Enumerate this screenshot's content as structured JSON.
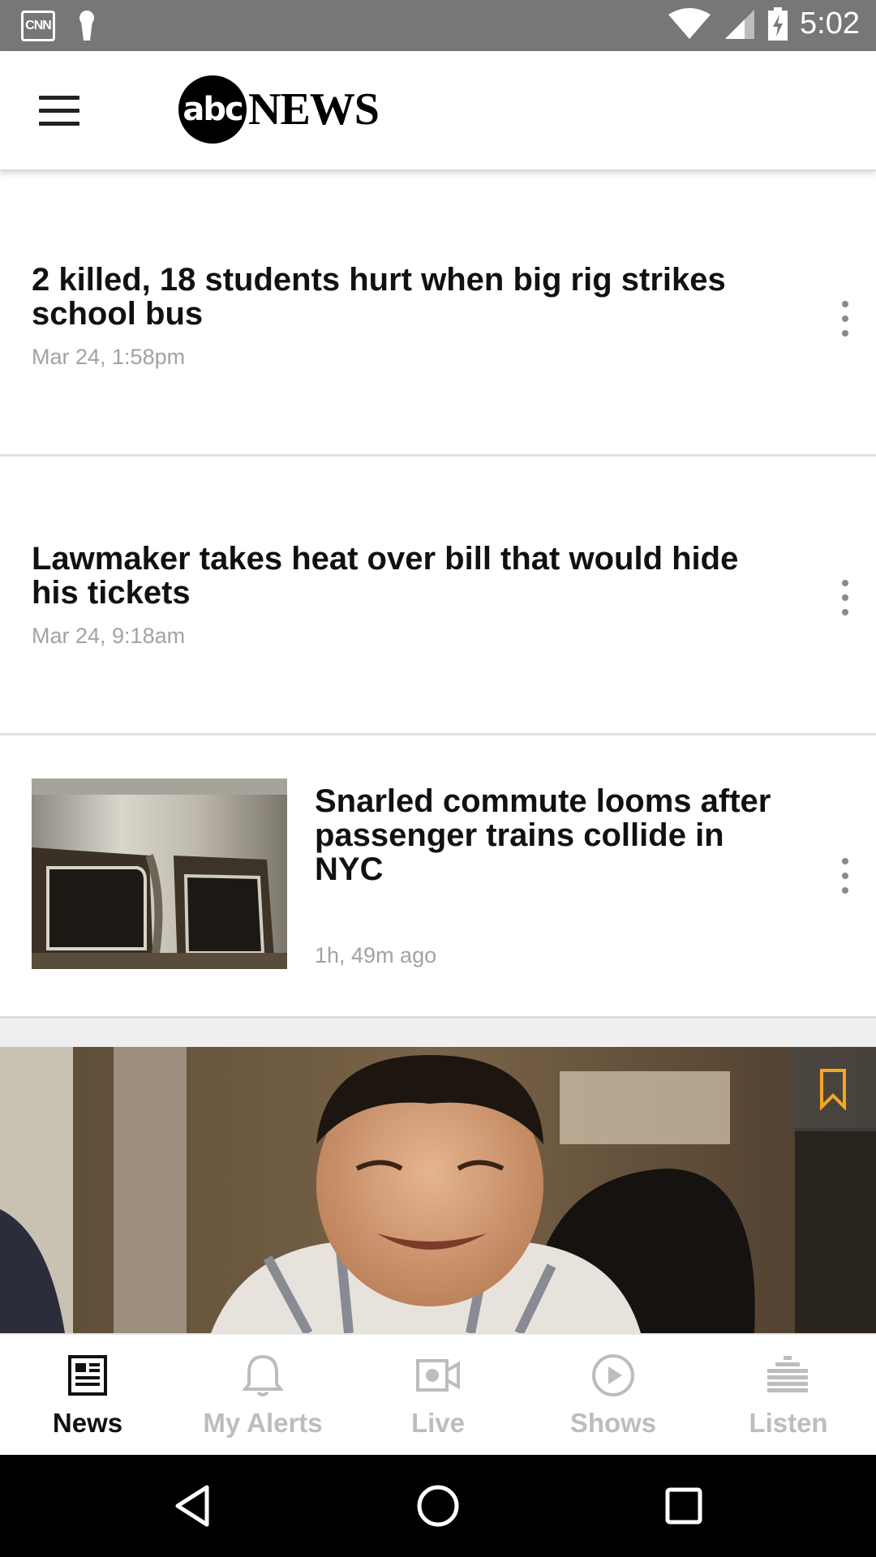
{
  "status_bar": {
    "time": "5:02",
    "left_icons": [
      "cnn-notification-icon",
      "keyhole-notification-icon"
    ],
    "right_icons": [
      "wifi-icon",
      "cell-signal-icon",
      "battery-charging-icon"
    ],
    "cnn_text": "CNN"
  },
  "header": {
    "menu_icon": "hamburger-menu-icon",
    "logo_abc": "abc",
    "logo_news": "NEWS"
  },
  "articles": [
    {
      "title": "2 killed, 18 students hurt when big rig strikes school bus",
      "time": "Mar 24, 1:58pm",
      "has_image": false
    },
    {
      "title": "Lawmaker takes heat over bill that would hide his tickets",
      "time": "Mar 24, 9:18am",
      "has_image": false
    },
    {
      "title": "Snarled commute looms after passenger trains collide in NYC",
      "time": "1h, 49m ago",
      "has_image": true
    }
  ],
  "hero": {
    "bookmark_icon": "bookmark-icon"
  },
  "bottom_nav": {
    "items": [
      {
        "label": "News",
        "icon": "newspaper-icon",
        "active": true
      },
      {
        "label": "My Alerts",
        "icon": "bell-icon",
        "active": false
      },
      {
        "label": "Live",
        "icon": "video-camera-icon",
        "active": false
      },
      {
        "label": "Shows",
        "icon": "play-circle-icon",
        "active": false
      },
      {
        "label": "Listen",
        "icon": "equalizer-icon",
        "active": false
      }
    ]
  },
  "system_nav": [
    "back-icon",
    "home-icon",
    "recents-icon"
  ],
  "colors": {
    "status_bar": "#777777",
    "accent_bookmark": "#f5a623",
    "nav_active": "#111111",
    "nav_inactive": "#bdbdbd",
    "timestamp": "#a2a2a2"
  }
}
